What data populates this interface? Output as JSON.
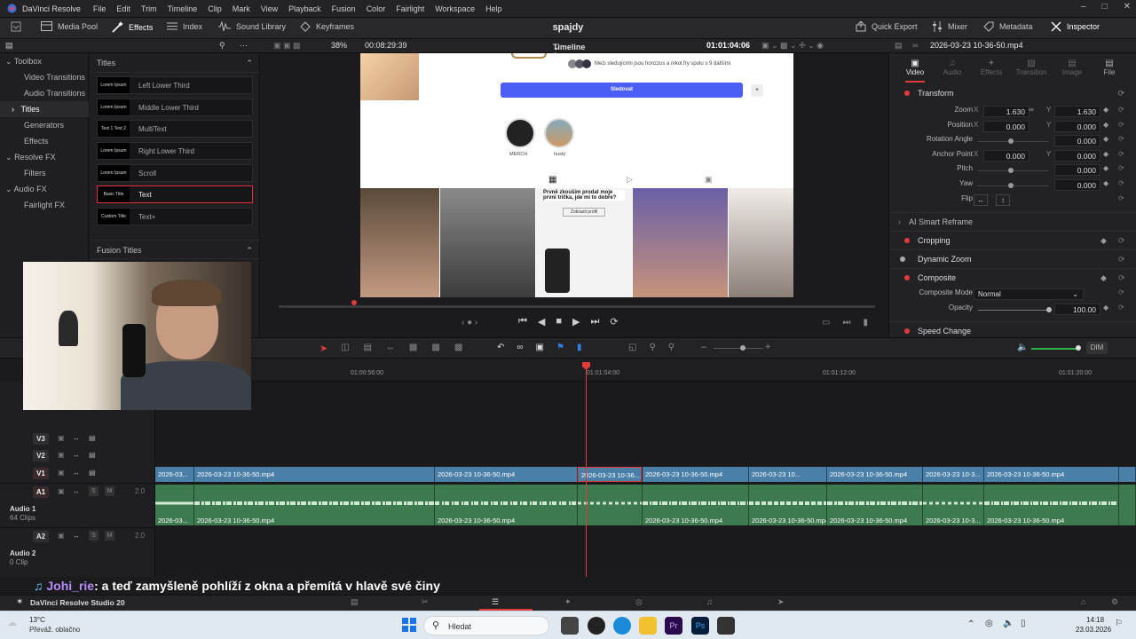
{
  "app": {
    "name": "DaVinci Resolve",
    "menu": [
      "File",
      "Edit",
      "Trim",
      "Timeline",
      "Clip",
      "Mark",
      "View",
      "Playback",
      "Fusion",
      "Color",
      "Fairlight",
      "Workspace",
      "Help"
    ]
  },
  "toolbar": {
    "media_pool": "Media Pool",
    "effects": "Effects",
    "index": "Index",
    "sound_library": "Sound Library",
    "keyframes": "Keyframes",
    "project": "spajdy",
    "quick_export": "Quick Export",
    "mixer": "Mixer",
    "metadata": "Metadata",
    "inspector": "Inspector"
  },
  "viewer_bar": {
    "zoom": "38%",
    "duration": "00:08:29:39",
    "timeline": "Timeline 1",
    "timecode": "01:01:04:06",
    "clip_name": "2026-03-23 10-36-50.mp4"
  },
  "effects_tree": [
    {
      "label": "Toolbox",
      "expanded": true
    },
    {
      "label": "Video Transitions"
    },
    {
      "label": "Audio Transitions"
    },
    {
      "label": "Titles",
      "selected": true
    },
    {
      "label": "Generators"
    },
    {
      "label": "Effects"
    },
    {
      "label": "Resolve FX",
      "expanded": true
    },
    {
      "label": "Filters"
    },
    {
      "label": "Audio FX",
      "expanded": true
    },
    {
      "label": "Fairlight FX"
    }
  ],
  "titles_panel": {
    "header": "Titles",
    "fusion_header": "Fusion Titles",
    "items": [
      {
        "thumb": "Lorem Ipsum",
        "label": "Left Lower Third"
      },
      {
        "thumb": "Lorem Ipsum",
        "label": "Middle Lower Third"
      },
      {
        "thumb": "Text 1 Text 2",
        "label": "MultiText"
      },
      {
        "thumb": "Lorem Ipsum",
        "label": "Right Lower Third"
      },
      {
        "thumb": "Lorem Ipsum",
        "label": "Scroll"
      },
      {
        "thumb": "Basic Title",
        "label": "Text",
        "selected": true
      },
      {
        "thumb": "Custom Title",
        "label": "Text+"
      }
    ]
  },
  "video_content": {
    "followers_text": "Mezi sledujícími jsou honzzus a nikol.fry spolu s 9 dalšími",
    "follow_button": "Sledovat",
    "highlights": [
      "MERCH",
      "hustý"
    ],
    "post_caption_1": "Prvně zkoušim prodat moje prvni trička, jde mi to dobře?",
    "post_button": "Zobrazit profil"
  },
  "inspector": {
    "tabs": [
      "Video",
      "Audio",
      "Effects",
      "Transition",
      "Image",
      "File"
    ],
    "transform_label": "Transform",
    "zoom": {
      "label": "Zoom",
      "x": "1.630",
      "y": "1.630"
    },
    "position": {
      "label": "Position",
      "x": "0.000",
      "y": "0.000"
    },
    "rotation": {
      "label": "Rotation Angle",
      "value": "0.000"
    },
    "anchor": {
      "label": "Anchor Point",
      "x": "0.000",
      "y": "0.000"
    },
    "pitch": {
      "label": "Pitch",
      "value": "0.000"
    },
    "yaw": {
      "label": "Yaw",
      "value": "0.000"
    },
    "flip": {
      "label": "Flip"
    },
    "ai_reframe": "AI Smart Reframe",
    "cropping": "Cropping",
    "dynamic_zoom": "Dynamic Zoom",
    "composite": "Composite",
    "composite_mode": {
      "label": "Composite Mode",
      "value": "Normal"
    },
    "opacity": {
      "label": "Opacity",
      "value": "100.00"
    },
    "speed_change": "Speed Change"
  },
  "timeline": {
    "ruler": [
      "01:00:56:00",
      "01:01:04:00",
      "01:01:12:00",
      "01:01:20:00"
    ],
    "tracks": {
      "v3": "V3",
      "v2": "V2",
      "v1": "V1",
      "a1": "A1",
      "a2": "A2",
      "audio1": "Audio 1",
      "audio1_clips": "64 Clips",
      "audio2": "Audio 2",
      "audio2_clips": "0 Clip",
      "a1_level": "2.0",
      "a2_level": "2.0"
    },
    "v1_clips": [
      "2026-03...",
      "2026-03-23 10-36-50.mp4",
      "2026-03-23 10-36-50.mp4",
      "2026-03-23 10-36...",
      "2026-03-23 10-36-50.mp4",
      "2026-03-23 10...",
      "2026-03-23 10-36-50.mp4",
      "2026-03-23 10-3...",
      "2026-03-23 10-36-50.mp4"
    ],
    "a1_clips": [
      "2026-03...",
      "2026-03-23 10-36-50.mp4",
      "2026-03-23 10-36-50.mp4",
      "",
      "2026-03-23 10-36-50.mp4",
      "2026-03-23 10-36-50.mp4",
      "2026-03-23 10-36-50.mp4",
      "2026-03-23 10-3...",
      "2026-03-23 10-36-50.mp4"
    ],
    "dim": "DIM"
  },
  "chat": {
    "user": "Johi_rie",
    "message": ": a teď zamyšleně pohlíží z okna a přemítá v hlavě své činy"
  },
  "status": {
    "version": "DaVinci Resolve Studio 20"
  },
  "taskbar": {
    "weather_temp": "13°C",
    "weather_desc": "Převáž. oblačno",
    "search": "Hledat",
    "time": "14:18",
    "date": "23.03.2026"
  }
}
